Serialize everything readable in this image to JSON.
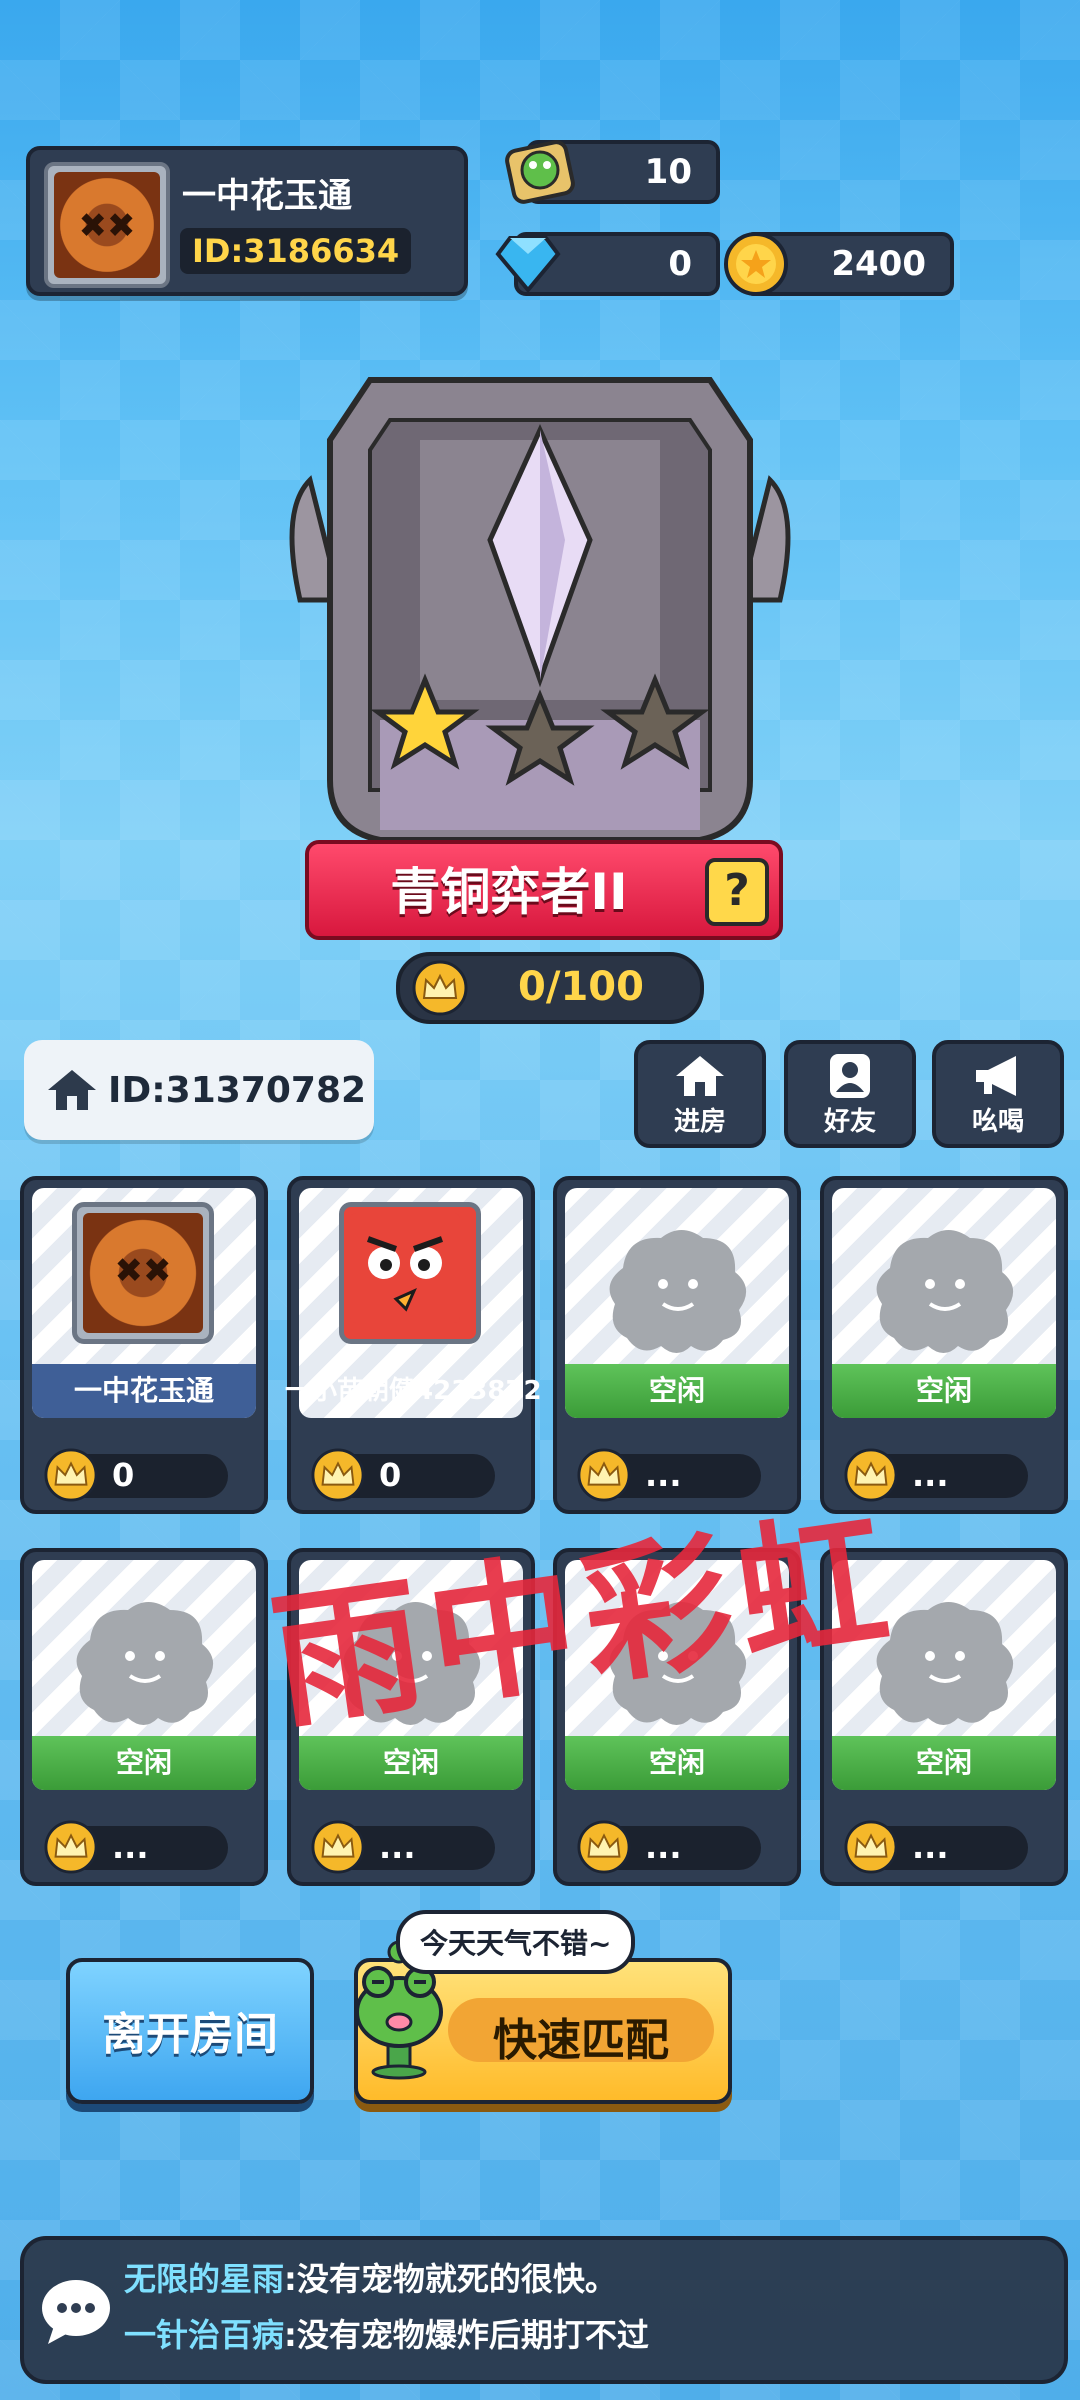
{
  "profile": {
    "name": "一中花玉通",
    "id": "ID:3186634"
  },
  "resources": {
    "frog_tokens": "10",
    "diamonds": "0",
    "coins": "2400"
  },
  "rank": {
    "title": "青铜弈者II",
    "help": "?",
    "progress": "0/100",
    "stars_filled": 1,
    "stars_total": 3
  },
  "room": {
    "id": "ID:31370782",
    "actions": [
      {
        "label": "进房",
        "icon": "house-icon"
      },
      {
        "label": "好友",
        "icon": "friend-icon"
      },
      {
        "label": "吆喝",
        "icon": "megaphone-icon"
      }
    ]
  },
  "seats": [
    {
      "name": "一中花玉通",
      "score": "0",
      "occupied": true
    },
    {
      "name": "一小苗朝健4233872",
      "score": "0",
      "occupied": true
    },
    {
      "name": "空闲",
      "score": "...",
      "occupied": false
    },
    {
      "name": "空闲",
      "score": "...",
      "occupied": false
    },
    {
      "name": "空闲",
      "score": "...",
      "occupied": false
    },
    {
      "name": "空闲",
      "score": "...",
      "occupied": false
    },
    {
      "name": "空闲",
      "score": "...",
      "occupied": false
    },
    {
      "name": "空闲",
      "score": "...",
      "occupied": false
    }
  ],
  "watermark": "雨中彩虹",
  "buttons": {
    "leave": "离开房间",
    "quick_match": "快速匹配"
  },
  "bubble": "今天天气不错~",
  "chat": [
    {
      "user": "无限的星雨",
      "msg": ":没有宠物就死的很快。"
    },
    {
      "user": "一针治百病",
      "msg": ":没有宠物爆炸后期打不过"
    }
  ]
}
